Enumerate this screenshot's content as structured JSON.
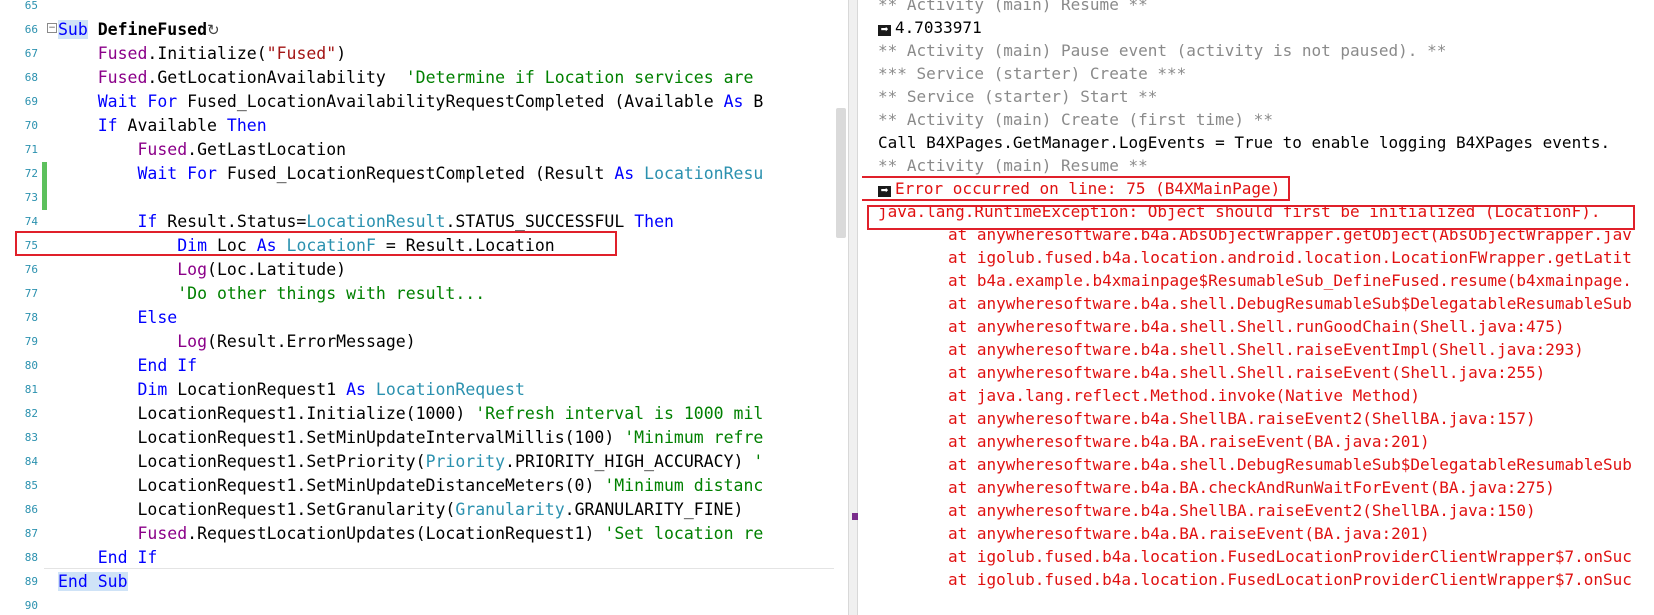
{
  "editor": {
    "lines": [
      {
        "n": "65",
        "parts": []
      },
      {
        "n": "66",
        "parts": [
          {
            "t": "Sub",
            "c": "kw sel"
          },
          {
            "t": " "
          },
          {
            "t": "DefineFused",
            "c": "bold"
          },
          {
            "t": "↻",
            "c": "reload"
          }
        ]
      },
      {
        "n": "67",
        "parts": [
          {
            "t": "    "
          },
          {
            "t": "Fused",
            "c": "cls"
          },
          {
            "t": ".Initialize("
          },
          {
            "t": "\"Fused\"",
            "c": "str"
          },
          {
            "t": ")"
          }
        ]
      },
      {
        "n": "68",
        "parts": [
          {
            "t": "    "
          },
          {
            "t": "Fused",
            "c": "cls"
          },
          {
            "t": ".GetLocationAvailability  "
          },
          {
            "t": "'Determine if Location services are",
            "c": "cmt"
          }
        ]
      },
      {
        "n": "69",
        "parts": [
          {
            "t": "    "
          },
          {
            "t": "Wait For",
            "c": "kw"
          },
          {
            "t": " Fused_LocationAvailabilityRequestCompleted (Available "
          },
          {
            "t": "As",
            "c": "kw"
          },
          {
            "t": " B"
          }
        ]
      },
      {
        "n": "70",
        "parts": [
          {
            "t": "    "
          },
          {
            "t": "If",
            "c": "kw"
          },
          {
            "t": " Available "
          },
          {
            "t": "Then",
            "c": "kw"
          }
        ]
      },
      {
        "n": "71",
        "parts": [
          {
            "t": "        "
          },
          {
            "t": "Fused",
            "c": "cls"
          },
          {
            "t": ".GetLastLocation"
          }
        ]
      },
      {
        "n": "72",
        "parts": [
          {
            "t": "        "
          },
          {
            "t": "Wait For",
            "c": "kw"
          },
          {
            "t": " Fused_LocationRequestCompleted (Result "
          },
          {
            "t": "As",
            "c": "kw"
          },
          {
            "t": " "
          },
          {
            "t": "LocationResu",
            "c": "typ"
          }
        ]
      },
      {
        "n": "73",
        "parts": []
      },
      {
        "n": "74",
        "parts": [
          {
            "t": "        "
          },
          {
            "t": "If",
            "c": "kw"
          },
          {
            "t": " Result.Status="
          },
          {
            "t": "LocationResult",
            "c": "typ"
          },
          {
            "t": ".STATUS_SUCCESSFUL "
          },
          {
            "t": "Then",
            "c": "kw"
          }
        ]
      },
      {
        "n": "75",
        "parts": [
          {
            "t": "            "
          },
          {
            "t": "Dim",
            "c": "kw"
          },
          {
            "t": " Loc "
          },
          {
            "t": "As",
            "c": "kw"
          },
          {
            "t": " "
          },
          {
            "t": "LocationF",
            "c": "typ"
          },
          {
            "t": " = Result.Location"
          }
        ]
      },
      {
        "n": "76",
        "parts": [
          {
            "t": "            "
          },
          {
            "t": "Log",
            "c": "cls"
          },
          {
            "t": "(Loc.Latitude)"
          }
        ]
      },
      {
        "n": "77",
        "parts": [
          {
            "t": "            "
          },
          {
            "t": "'Do other things with result...",
            "c": "cmt"
          }
        ]
      },
      {
        "n": "78",
        "parts": [
          {
            "t": "        "
          },
          {
            "t": "Else",
            "c": "kw"
          }
        ]
      },
      {
        "n": "79",
        "parts": [
          {
            "t": "            "
          },
          {
            "t": "Log",
            "c": "cls"
          },
          {
            "t": "(Result.ErrorMessage)"
          }
        ]
      },
      {
        "n": "80",
        "parts": [
          {
            "t": "        "
          },
          {
            "t": "End If",
            "c": "kw"
          }
        ]
      },
      {
        "n": "81",
        "parts": [
          {
            "t": "        "
          },
          {
            "t": "Dim",
            "c": "kw"
          },
          {
            "t": " LocationRequest1 "
          },
          {
            "t": "As",
            "c": "kw"
          },
          {
            "t": " "
          },
          {
            "t": "LocationRequest",
            "c": "typ"
          }
        ]
      },
      {
        "n": "82",
        "parts": [
          {
            "t": "        LocationRequest1.Initialize(1000) "
          },
          {
            "t": "'Refresh interval is 1000 mil",
            "c": "cmt"
          }
        ]
      },
      {
        "n": "83",
        "parts": [
          {
            "t": "        LocationRequest1.SetMinUpdateIntervalMillis(100) "
          },
          {
            "t": "'Minimum refre",
            "c": "cmt"
          }
        ]
      },
      {
        "n": "84",
        "parts": [
          {
            "t": "        LocationRequest1.SetPriority("
          },
          {
            "t": "Priority",
            "c": "typ"
          },
          {
            "t": ".PRIORITY_HIGH_ACCURACY) "
          },
          {
            "t": "'",
            "c": "cmt"
          }
        ]
      },
      {
        "n": "85",
        "parts": [
          {
            "t": "        LocationRequest1.SetMinUpdateDistanceMeters(0) "
          },
          {
            "t": "'Minimum distanc",
            "c": "cmt"
          }
        ]
      },
      {
        "n": "86",
        "parts": [
          {
            "t": "        LocationRequest1.SetGranularity("
          },
          {
            "t": "Granularity",
            "c": "typ"
          },
          {
            "t": ".GRANULARITY_FINE)"
          }
        ]
      },
      {
        "n": "87",
        "parts": [
          {
            "t": "        "
          },
          {
            "t": "Fused",
            "c": "cls"
          },
          {
            "t": ".RequestLocationUpdates(LocationRequest1) "
          },
          {
            "t": "'Set location re",
            "c": "cmt"
          }
        ]
      },
      {
        "n": "88",
        "parts": [
          {
            "t": "    "
          },
          {
            "t": "End If",
            "c": "kw"
          }
        ]
      },
      {
        "n": "89",
        "parts": [
          {
            "t": "End Sub",
            "c": "kw sel"
          }
        ]
      },
      {
        "n": "90",
        "parts": []
      }
    ]
  },
  "logs": {
    "lines": [
      {
        "t": "** Activity (main) Resume **",
        "c": "g"
      },
      {
        "t": "4.7033971",
        "c": "",
        "arrow": true
      },
      {
        "t": "** Activity (main) Pause event (activity is not paused). **",
        "c": "g"
      },
      {
        "t": "*** Service (starter) Create ***",
        "c": "g"
      },
      {
        "t": "** Service (starter) Start **",
        "c": "g"
      },
      {
        "t": "** Activity (main) Create (first time) **",
        "c": "g"
      },
      {
        "t": "Call B4XPages.GetManager.LogEvents = True to enable logging B4XPages events.",
        "c": ""
      },
      {
        "t": "** Activity (main) Resume **",
        "c": "g"
      },
      {
        "t": "Error occurred on line: 75 (B4XMainPage)",
        "c": "r",
        "arrow": true
      },
      {
        "t": "java.lang.RuntimeException: Object should first be initialized (LocationF).",
        "c": "r"
      },
      {
        "t": "at anywheresoftware.b4a.AbsObjectWrapper.getObject(AbsObjectWrapper.jav",
        "c": "r",
        "ind": true
      },
      {
        "t": "at igolub.fused.b4a.location.android.location.LocationFWrapper.getLatit",
        "c": "r",
        "ind": true
      },
      {
        "t": "at b4a.example.b4xmainpage$ResumableSub_DefineFused.resume(b4xmainpage.",
        "c": "r",
        "ind": true
      },
      {
        "t": "at anywheresoftware.b4a.shell.DebugResumableSub$DelegatableResumableSub",
        "c": "r",
        "ind": true
      },
      {
        "t": "at anywheresoftware.b4a.shell.Shell.runGoodChain(Shell.java:475)",
        "c": "r",
        "ind": true
      },
      {
        "t": "at anywheresoftware.b4a.shell.Shell.raiseEventImpl(Shell.java:293)",
        "c": "r",
        "ind": true
      },
      {
        "t": "at anywheresoftware.b4a.shell.Shell.raiseEvent(Shell.java:255)",
        "c": "r",
        "ind": true
      },
      {
        "t": "at java.lang.reflect.Method.invoke(Native Method)",
        "c": "r",
        "ind": true
      },
      {
        "t": "at anywheresoftware.b4a.ShellBA.raiseEvent2(ShellBA.java:157)",
        "c": "r",
        "ind": true
      },
      {
        "t": "at anywheresoftware.b4a.BA.raiseEvent(BA.java:201)",
        "c": "r",
        "ind": true
      },
      {
        "t": "at anywheresoftware.b4a.shell.DebugResumableSub$DelegatableResumableSub",
        "c": "r",
        "ind": true
      },
      {
        "t": "at anywheresoftware.b4a.BA.checkAndRunWaitForEvent(BA.java:275)",
        "c": "r",
        "ind": true
      },
      {
        "t": "at anywheresoftware.b4a.ShellBA.raiseEvent2(ShellBA.java:150)",
        "c": "r",
        "ind": true
      },
      {
        "t": "at anywheresoftware.b4a.BA.raiseEvent(BA.java:201)",
        "c": "r",
        "ind": true
      },
      {
        "t": "at igolub.fused.b4a.location.FusedLocationProviderClientWrapper$7.onSuc",
        "c": "r",
        "ind": true
      },
      {
        "t": "at igolub.fused.b4a.location.FusedLocationProviderClientWrapper$7.onSuc",
        "c": "r",
        "ind": true
      }
    ]
  },
  "colors": {
    "error": "#e01010",
    "highlight_box": "#e0202a",
    "keyword": "#0000ff",
    "type": "#2b91af",
    "comment": "#008000",
    "string": "#a31515",
    "member": "#8b0089"
  }
}
